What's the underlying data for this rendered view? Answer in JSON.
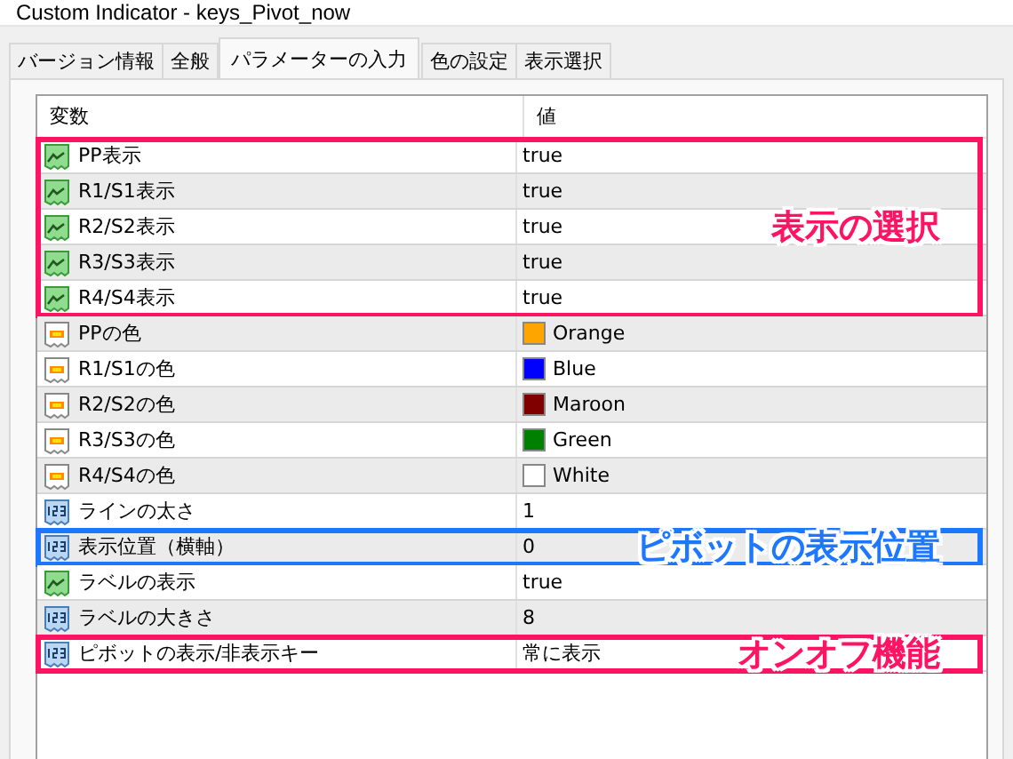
{
  "window": {
    "title": "Custom Indicator - keys_Pivot_now"
  },
  "tabs": [
    {
      "label": "バージョン情報",
      "selected": false
    },
    {
      "label": "全般",
      "selected": false
    },
    {
      "label": "パラメーターの入力",
      "selected": true
    },
    {
      "label": "色の設定",
      "selected": false
    },
    {
      "label": "表示選択",
      "selected": false
    }
  ],
  "table": {
    "columns": [
      "変数",
      "値"
    ],
    "groups": [
      {
        "highlight": {
          "label": "表示の選択",
          "color": "#ff1464"
        },
        "rows": [
          {
            "kind": "bool",
            "name": "PP表示",
            "value": "true"
          },
          {
            "kind": "bool",
            "name": "R1/S1表示",
            "value": "true"
          },
          {
            "kind": "bool",
            "name": "R2/S2表示",
            "value": "true"
          },
          {
            "kind": "bool",
            "name": "R3/S3表示",
            "value": "true"
          },
          {
            "kind": "bool",
            "name": "R4/S4表示",
            "value": "true"
          }
        ]
      },
      {
        "rows": [
          {
            "kind": "color",
            "name": "PPの色",
            "value": "Orange",
            "color": "#ffa500"
          },
          {
            "kind": "color",
            "name": "R1/S1の色",
            "value": "Blue",
            "color": "#0000ff"
          },
          {
            "kind": "color",
            "name": "R2/S2の色",
            "value": "Maroon",
            "color": "#800000"
          },
          {
            "kind": "color",
            "name": "R3/S3の色",
            "value": "Green",
            "color": "#008000"
          },
          {
            "kind": "color",
            "name": "R4/S4の色",
            "value": "White",
            "color": "#ffffff"
          },
          {
            "kind": "int",
            "name": "ラインの太さ",
            "value": "1"
          }
        ]
      },
      {
        "highlight": {
          "label": "ピボットの表示位置",
          "color": "#1e78ff"
        },
        "rows": [
          {
            "kind": "int",
            "name": "表示位置（横軸）",
            "value": "0"
          }
        ]
      },
      {
        "rows": [
          {
            "kind": "bool",
            "name": "ラベルの表示",
            "value": "true"
          },
          {
            "kind": "int",
            "name": "ラベルの大きさ",
            "value": "8"
          }
        ]
      },
      {
        "highlight": {
          "label": "オンオフ機能",
          "color": "#ff1464"
        },
        "rows": [
          {
            "kind": "int",
            "name": "ピボットの表示/非表示キー",
            "value": "常に表示"
          }
        ]
      }
    ]
  }
}
